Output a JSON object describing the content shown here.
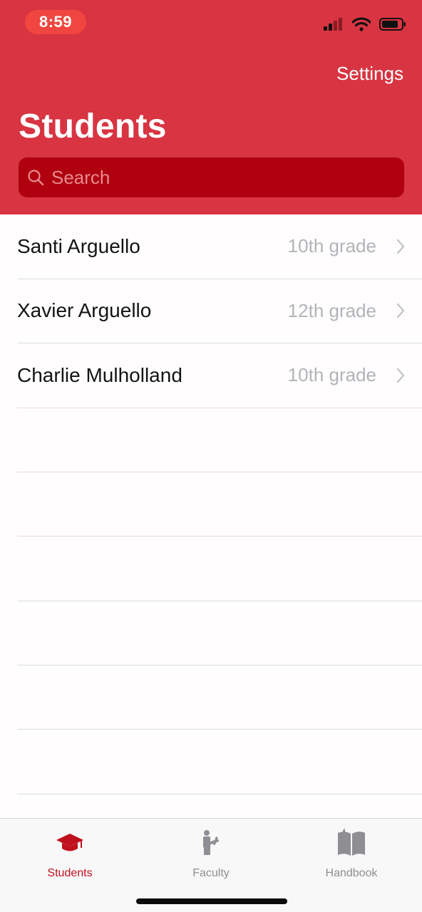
{
  "status_bar": {
    "time": "8:59"
  },
  "header": {
    "settings_label": "Settings",
    "title": "Students"
  },
  "search": {
    "placeholder": "Search"
  },
  "students": [
    {
      "name": "Santi Arguello",
      "grade": "10th grade"
    },
    {
      "name": "Xavier Arguello",
      "grade": "12th grade"
    },
    {
      "name": "Charlie Mulholland",
      "grade": "10th grade"
    }
  ],
  "tabs": [
    {
      "label": "Students",
      "icon": "graduation-cap-icon",
      "selected": true
    },
    {
      "label": "Faculty",
      "icon": "teacher-icon",
      "selected": false
    },
    {
      "label": "Handbook",
      "icon": "book-icon",
      "selected": false
    }
  ],
  "colors": {
    "header_background": "#d83442",
    "search_background": "#b0000f",
    "selected_tab": "#c0101d",
    "unselected_tab": "#8e8e93"
  }
}
